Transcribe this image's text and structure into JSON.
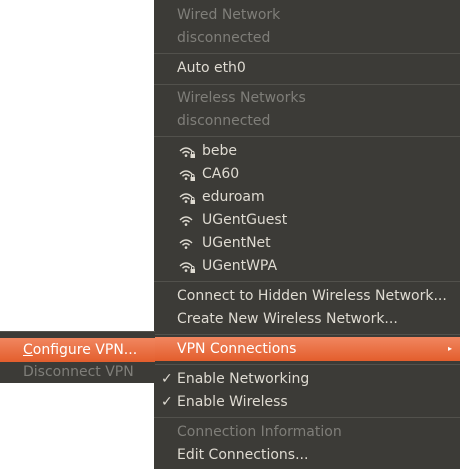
{
  "menu": {
    "wired_section": {
      "title": "Wired Network",
      "status": "disconnected"
    },
    "wired_items": [
      {
        "label": "Auto eth0"
      }
    ],
    "wireless_section": {
      "title": "Wireless Networks",
      "status": "disconnected"
    },
    "wireless_networks": [
      {
        "label": "bebe",
        "icon": "wifi-signal-secured-icon"
      },
      {
        "label": "CA60",
        "icon": "wifi-signal-secured-icon"
      },
      {
        "label": "eduroam",
        "icon": "wifi-signal-secured-icon"
      },
      {
        "label": "UGentGuest",
        "icon": "wifi-signal-icon"
      },
      {
        "label": "UGentNet",
        "icon": "wifi-signal-icon"
      },
      {
        "label": "UGentWPA",
        "icon": "wifi-signal-secured-icon"
      }
    ],
    "connect_hidden": "Connect to Hidden Wireless Network...",
    "create_new": "Create New Wireless Network...",
    "vpn_connections": "VPN Connections",
    "submenu_arrow": "▸",
    "enable_networking": "Enable Networking",
    "enable_wireless": "Enable Wireless",
    "check_mark": "✓",
    "connection_information": "Connection Information",
    "edit_connections": "Edit Connections..."
  },
  "vpn_submenu": {
    "configure_first_letter": "C",
    "configure_rest": "onfigure VPN...",
    "disconnect": "Disconnect VPN"
  },
  "colors": {
    "menu_bg": "#3c3b37",
    "text": "#dfdbd2",
    "disabled_text": "#7f7e79",
    "highlight": "#e35e2d"
  }
}
